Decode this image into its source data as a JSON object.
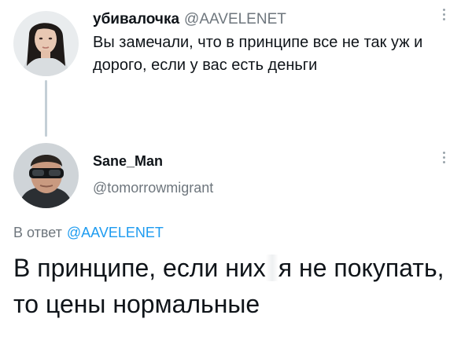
{
  "tweet1": {
    "display_name": "убивалочка",
    "handle": "@AAVELENET",
    "text": "Вы замечали, что в принципе все не так уж и дорого, если у вас есть деньги"
  },
  "tweet2": {
    "display_name": "Sane_Man",
    "handle": "@tomorrowmigrant",
    "reply_prefix": "В ответ",
    "reply_mention": "@AAVELENET",
    "text_part1": "В принципе, если них",
    "text_part2": "я не покупать, то цены нормальные"
  },
  "icons": {
    "more": "more-vertical-icon"
  },
  "colors": {
    "text": "#0f1419",
    "secondary": "#6e767d",
    "link": "#1d9bf0",
    "thread_line": "#c4cfd6"
  }
}
